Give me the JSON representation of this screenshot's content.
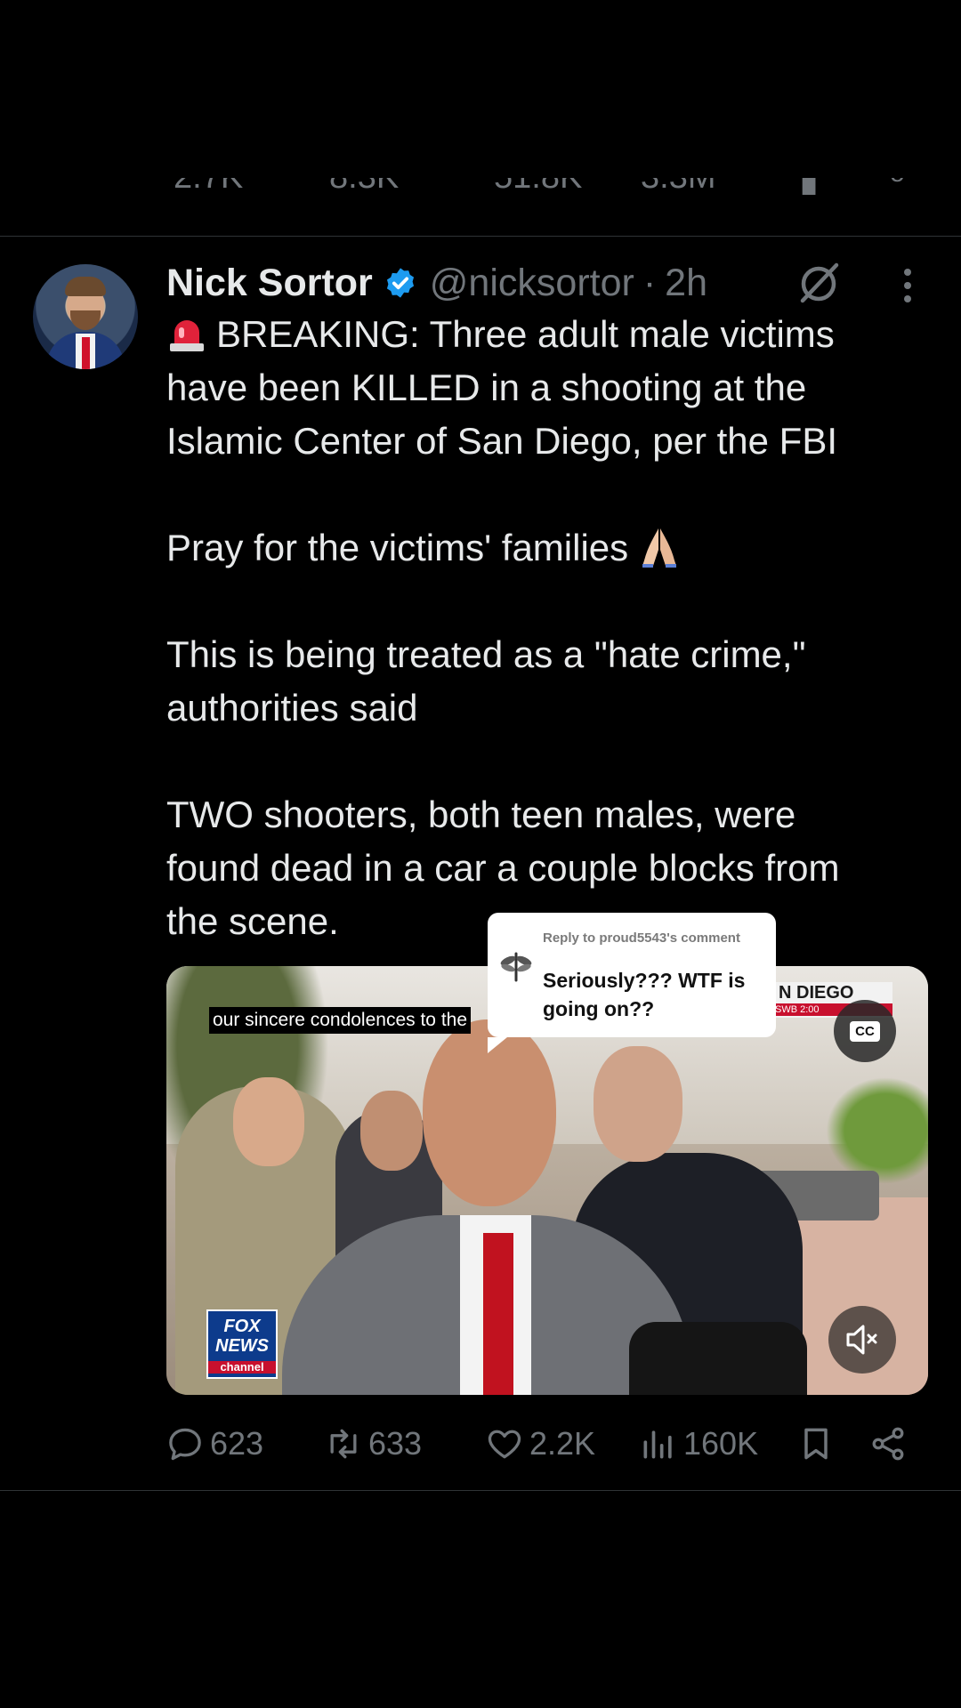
{
  "previous_post": {
    "replies": "2.7K",
    "reposts": "8.3K",
    "likes": "51.8K",
    "views": "3.3M"
  },
  "post": {
    "author_name": "Nick Sortor",
    "handle": "@nicksortor",
    "time": "2h",
    "separator": "·",
    "body_line1": "BREAKING: Three adult male victims",
    "body_rest": "have been KILLED in a shooting at the\nIslamic Center of San Diego, per the FBI\n\nPray for the victims' families ",
    "body_tail": "\n\nThis is being treated as a \"hate crime,\"\nauthorities said\n\nTWO shooters, both teen males, were\nfound dead in a car a couple blocks from\nthe scene."
  },
  "video": {
    "caption": "our sincere condolences to the",
    "banner_top": "N DIEGO",
    "banner_bottom": "SWB   2:00",
    "cc_label": "CC",
    "logo_line1": "FOX",
    "logo_line2": "NEWS",
    "logo_line3": "channel"
  },
  "reply_bubble": {
    "label": "Reply to proud5543's comment",
    "text": "Seriously??? WTF is going on??"
  },
  "actions": {
    "replies": "623",
    "reposts": "633",
    "likes": "2.2K",
    "views": "160K"
  },
  "colors": {
    "background": "#000000",
    "text": "#e7e9ea",
    "secondary": "#71767b",
    "verified": "#1d9bf0",
    "divider": "#2f3336"
  },
  "icons": [
    "reply-icon",
    "repost-icon",
    "like-icon",
    "views-icon",
    "bookmark-icon",
    "share-icon",
    "verified-icon",
    "grok-icon",
    "more-icon",
    "mute-icon",
    "siren-emoji",
    "pray-emoji"
  ]
}
